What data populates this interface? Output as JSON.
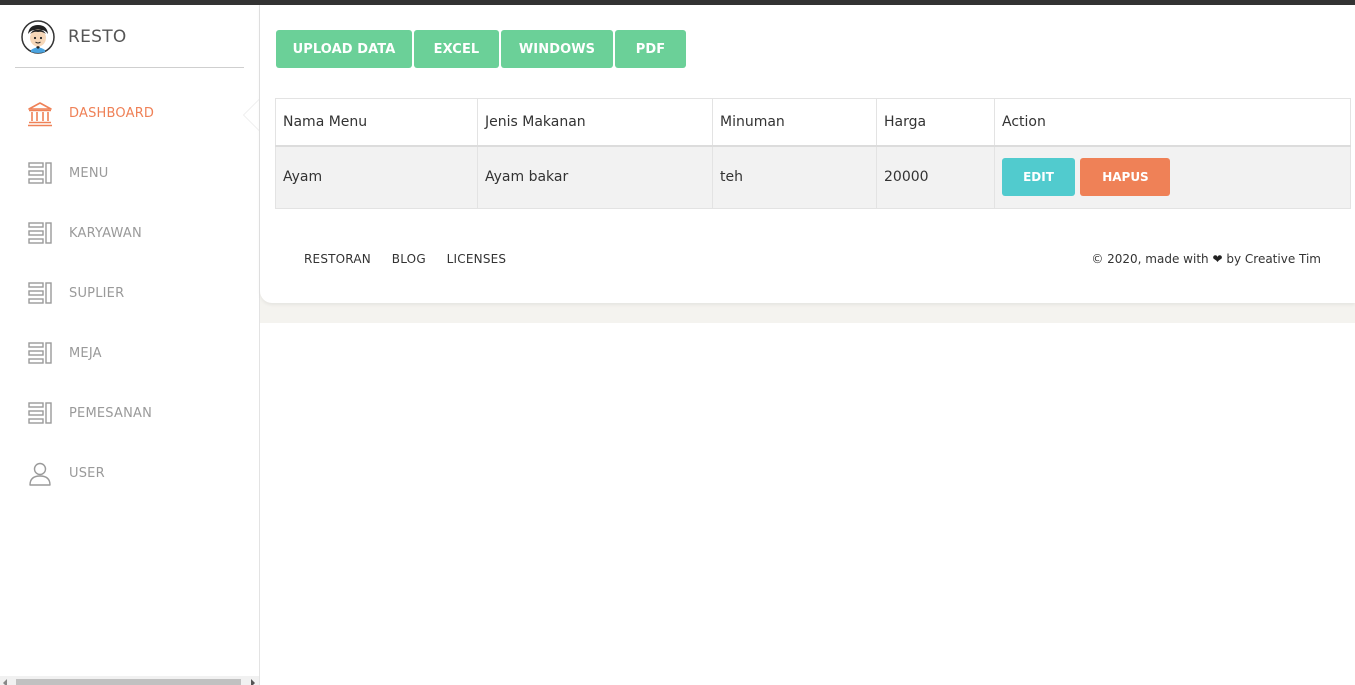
{
  "app": {
    "brand": "RESTO"
  },
  "sidebar": {
    "items": [
      {
        "label": "DASHBOARD",
        "icon": "bank-icon",
        "active": true
      },
      {
        "label": "MENU",
        "icon": "list-icon",
        "active": false
      },
      {
        "label": "KARYAWAN",
        "icon": "list-icon",
        "active": false
      },
      {
        "label": "SUPLIER",
        "icon": "list-icon",
        "active": false
      },
      {
        "label": "MEJA",
        "icon": "list-icon",
        "active": false
      },
      {
        "label": "PEMESANAN",
        "icon": "list-icon",
        "active": false
      },
      {
        "label": "USER",
        "icon": "user-icon",
        "active": false
      }
    ]
  },
  "toolbar": {
    "upload_label": "UPLOAD DATA",
    "excel_label": "EXCEL",
    "windows_label": "WINDOWS",
    "pdf_label": "PDF"
  },
  "table": {
    "headers": [
      "Nama Menu",
      "Jenis Makanan",
      "Minuman",
      "Harga",
      "Action"
    ],
    "rows": [
      {
        "nama_menu": "Ayam",
        "jenis_makanan": "Ayam bakar",
        "minuman": "teh",
        "harga": "20000",
        "edit_label": "EDIT",
        "hapus_label": "HAPUS"
      }
    ]
  },
  "footer": {
    "links": [
      "RESTORAN",
      "BLOG",
      "LICENSES"
    ],
    "copyright_prefix": "© 2020, made with",
    "copyright_suffix": "by Creative Tim"
  },
  "colors": {
    "accent_active": "#ef8157",
    "button_green": "#6bd098",
    "button_edit": "#51cbce",
    "button_hapus": "#ef8157"
  }
}
